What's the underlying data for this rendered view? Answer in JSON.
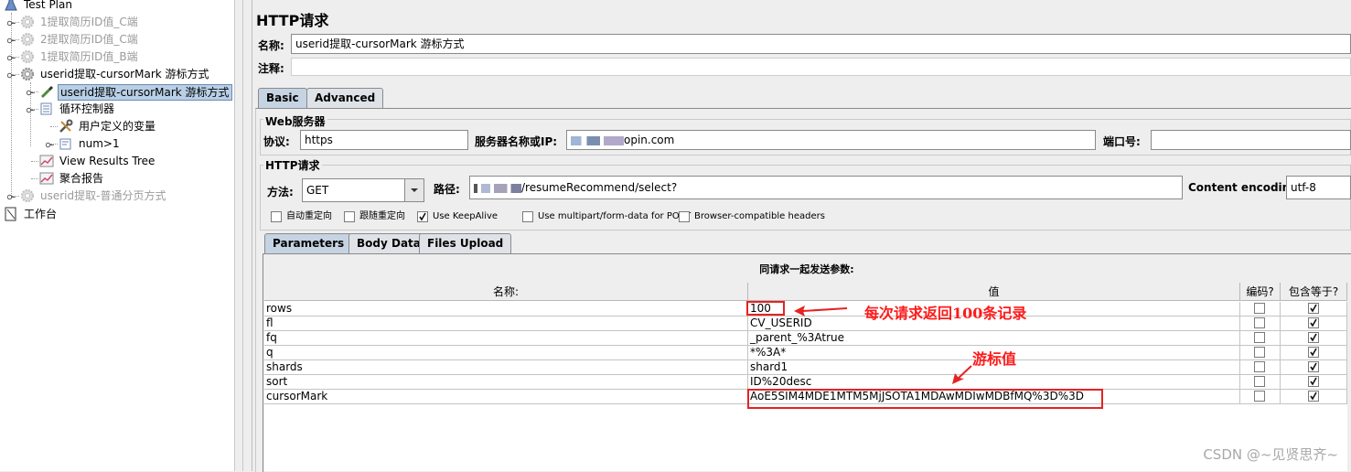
{
  "tree": {
    "root": "Test Plan",
    "items": [
      {
        "label": "1提取简历ID值_C端",
        "disabled": true,
        "icon": "gear-icon"
      },
      {
        "label": "2提取简历ID值_C端",
        "disabled": true,
        "icon": "gear-icon"
      },
      {
        "label": "1提取简历ID值_B端",
        "disabled": true,
        "icon": "gear-icon"
      },
      {
        "label": "userid提取-cursorMark 游标方式",
        "disabled": false,
        "icon": "gear-icon"
      },
      {
        "label": "userid提取-cursorMark 游标方式",
        "disabled": false,
        "icon": "pipette-icon",
        "selected": true
      },
      {
        "label": "循环控制器",
        "disabled": false,
        "icon": "loop-icon"
      },
      {
        "label": "用户定义的变量",
        "disabled": false,
        "icon": "wrench-icon"
      },
      {
        "label": "num>1",
        "disabled": false,
        "icon": "if-icon"
      },
      {
        "label": "View Results Tree",
        "disabled": false,
        "icon": "chart-icon"
      },
      {
        "label": "聚合报告",
        "disabled": false,
        "icon": "chart-icon"
      },
      {
        "label": "userid提取-普通分页方式",
        "disabled": true,
        "icon": "gear-icon"
      }
    ],
    "workbench": "工作台"
  },
  "panel": {
    "title": "HTTP请求",
    "name_label": "名称:",
    "name_value": "userid提取-cursorMark 游标方式",
    "comment_label": "注释:",
    "comment_value": ""
  },
  "tabs": {
    "basic": "Basic",
    "advanced": "Advanced"
  },
  "web_server": {
    "group_title": "Web服务器",
    "protocol_label": "协议:",
    "protocol_value": "https",
    "server_label": "服务器名称或IP:",
    "server_value": "opin.com",
    "port_label": "端口号:",
    "port_value": ""
  },
  "http_request": {
    "group_title": "HTTP请求",
    "method_label": "方法:",
    "method_value": "GET",
    "path_label": "路径:",
    "path_value": "/resumeRecommend/select?",
    "encoding_label": "Content encoding:",
    "encoding_value": "utf-8"
  },
  "options": [
    {
      "label": "自动重定向",
      "checked": false
    },
    {
      "label": "跟随重定向",
      "checked": false
    },
    {
      "label": "Use KeepAlive",
      "checked": true
    },
    {
      "label": "Use multipart/form-data for POST",
      "checked": false
    },
    {
      "label": "Browser-compatible headers",
      "checked": false
    }
  ],
  "subtabs": {
    "parameters": "Parameters",
    "body": "Body Data",
    "files": "Files Upload"
  },
  "params": {
    "caption": "同请求一起发送参数:",
    "headers": {
      "name": "名称:",
      "value": "值",
      "encode": "编码?",
      "include": "包含等于?"
    },
    "rows": [
      {
        "name": "rows",
        "value": "100",
        "encode": false,
        "include": true
      },
      {
        "name": "fl",
        "value": "CV_USERID",
        "encode": false,
        "include": true
      },
      {
        "name": "fq",
        "value": "_parent_%3Atrue",
        "encode": false,
        "include": true
      },
      {
        "name": "q",
        "value": "*%3A*",
        "encode": false,
        "include": true
      },
      {
        "name": "shards",
        "value": "shard1",
        "encode": false,
        "include": true
      },
      {
        "name": "sort",
        "value": "ID%20desc",
        "encode": false,
        "include": true
      },
      {
        "name": "cursorMark",
        "value": "AoE5SIM4MDE1MTM5MjJSOTA1MDAwMDIwMDBfMQ%3D%3D",
        "encode": false,
        "include": true
      }
    ]
  },
  "annotations": {
    "rows_note": "每次请求返回100条记录",
    "cursor_note": "游标值",
    "color": "#ff1a1a"
  },
  "watermark": "CSDN @~见贤思齐~"
}
